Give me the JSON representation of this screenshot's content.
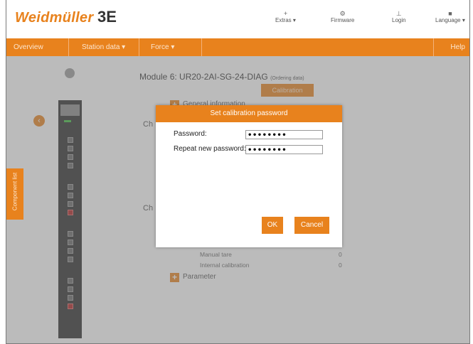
{
  "header": {
    "brand": "Weidmüller",
    "logo_mark": "3E",
    "items": [
      {
        "label": "Extras ▾",
        "icon": "+"
      },
      {
        "label": "Firmware",
        "icon": "⚙"
      },
      {
        "label": "Login",
        "icon": "⊥"
      },
      {
        "label": "Language ▾",
        "icon": "■"
      }
    ]
  },
  "navbar": {
    "items": [
      "Overview",
      "Station data ▾",
      "Force ▾"
    ],
    "help": "Help"
  },
  "sidebar": {
    "compare_tab": "Component list",
    "collapse_icon": "‹"
  },
  "module": {
    "title": "Module 6: UR20-2AI-SG-24-DIAG",
    "ordering": "(Ordering data)",
    "calibration_button": "Calibration",
    "general_info": "General information",
    "ch1": "Ch",
    "ch2": "Ch",
    "rows": [
      {
        "label": "Manual tare",
        "value": "0"
      },
      {
        "label": "Internal calibration",
        "value": "0"
      }
    ],
    "parameter": "Parameter"
  },
  "dialog": {
    "title": "Set calibration password",
    "password_label": "Password:",
    "password_value": "••••••••",
    "repeat_label": "Repeat new password:",
    "repeat_value": "••••••••",
    "ok": "OK",
    "cancel": "Cancel"
  },
  "colors": {
    "accent": "#e8821d"
  }
}
